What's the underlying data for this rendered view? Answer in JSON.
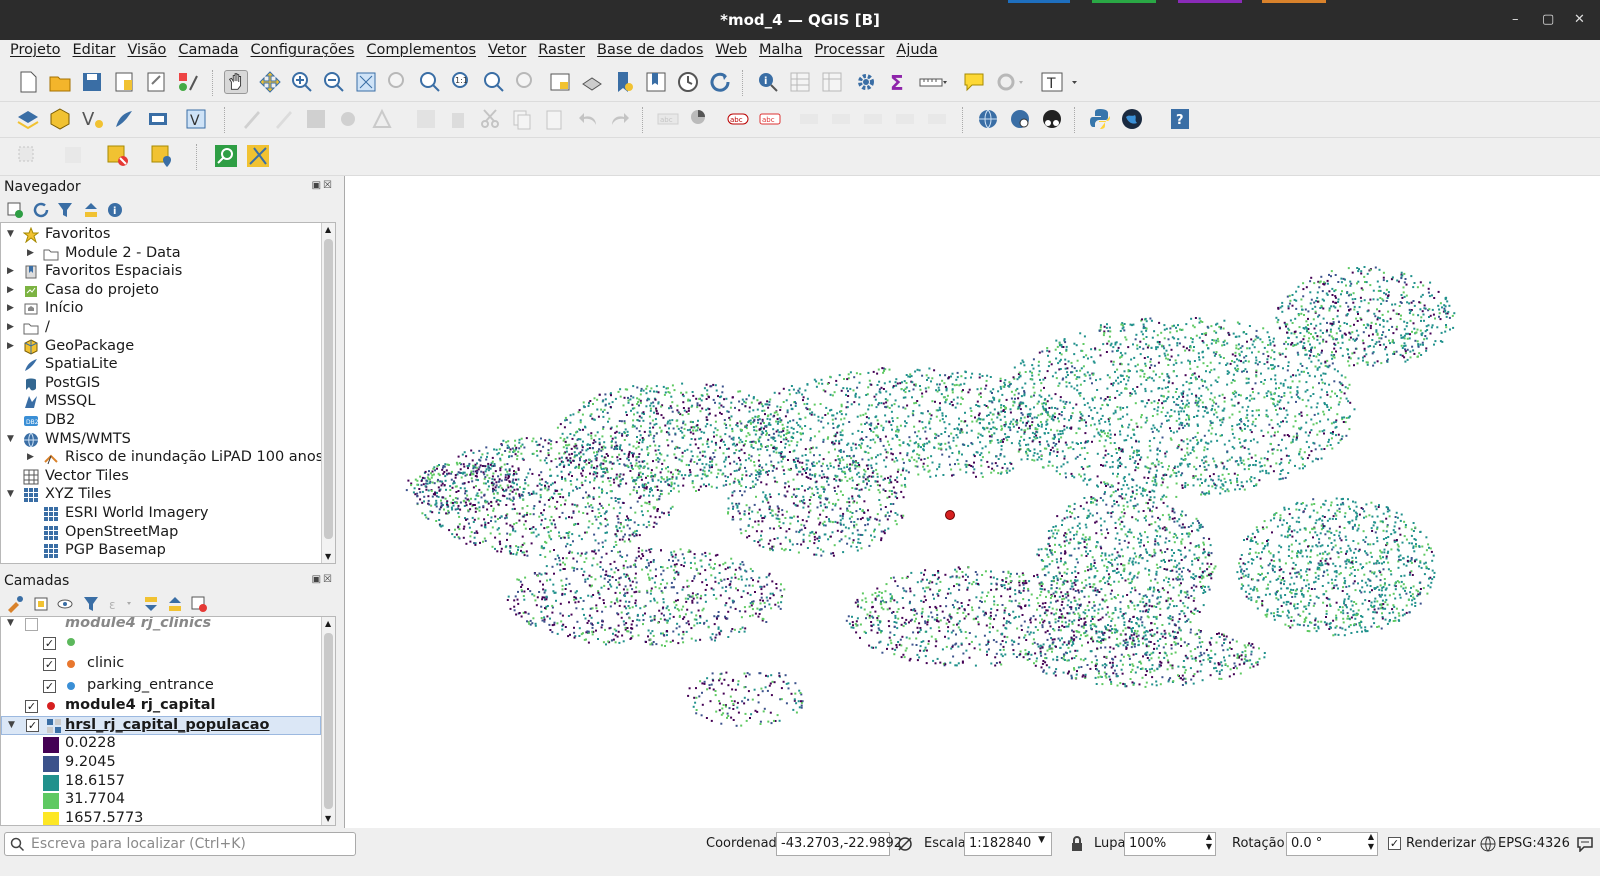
{
  "window": {
    "title": "*mod_4 — QGIS [B]"
  },
  "menu": [
    "Projeto",
    "Editar",
    "Visão",
    "Camada",
    "Configurações",
    "Complementos",
    "Vetor",
    "Raster",
    "Base de dados",
    "Web",
    "Malha",
    "Processar",
    "Ajuda"
  ],
  "navigator": {
    "title": "Navegador",
    "items": [
      {
        "label": "Favoritos",
        "icon": "star-icon",
        "expand": "open",
        "indent": 0
      },
      {
        "label": "Module 2 - Data",
        "icon": "folder-icon",
        "expand": "closed",
        "indent": 1
      },
      {
        "label": "Favoritos Espaciais",
        "icon": "spatial-bookmark-icon",
        "expand": "closed",
        "indent": 0
      },
      {
        "label": "Casa do projeto",
        "icon": "project-home-icon",
        "expand": "closed",
        "indent": 0
      },
      {
        "label": "Início",
        "icon": "home-folder-icon",
        "expand": "closed",
        "indent": 0
      },
      {
        "label": "/",
        "icon": "folder-icon",
        "expand": "closed",
        "indent": 0
      },
      {
        "label": "GeoPackage",
        "icon": "geopackage-icon",
        "expand": "closed",
        "indent": 0
      },
      {
        "label": "SpatiaLite",
        "icon": "spatialite-icon",
        "expand": "none",
        "indent": 0
      },
      {
        "label": "PostGIS",
        "icon": "postgis-icon",
        "expand": "none",
        "indent": 0
      },
      {
        "label": "MSSQL",
        "icon": "mssql-icon",
        "expand": "none",
        "indent": 0
      },
      {
        "label": "DB2",
        "icon": "db2-icon",
        "expand": "none",
        "indent": 0
      },
      {
        "label": "WMS/WMTS",
        "icon": "globe-icon",
        "expand": "open",
        "indent": 0
      },
      {
        "label": "Risco de inundação LiPAD 100 anos",
        "icon": "wms-layer-icon",
        "expand": "closed",
        "indent": 1
      },
      {
        "label": "Vector Tiles",
        "icon": "vector-tiles-icon",
        "expand": "none",
        "indent": 0
      },
      {
        "label": "XYZ Tiles",
        "icon": "xyz-tiles-icon",
        "expand": "open",
        "indent": 0
      },
      {
        "label": "ESRI World Imagery",
        "icon": "xyz-tiles-icon",
        "expand": "none",
        "indent": 1
      },
      {
        "label": "OpenStreetMap",
        "icon": "xyz-tiles-icon",
        "expand": "none",
        "indent": 1
      },
      {
        "label": "PGP Basemap",
        "icon": "xyz-tiles-icon",
        "expand": "none",
        "indent": 1
      }
    ]
  },
  "layers": {
    "title": "Camadas",
    "group_partial": "module4 rj_clinics",
    "clinic_subclasses": [
      {
        "label": "",
        "color": "#5cb85c"
      },
      {
        "label": "clinic",
        "color": "#e8772e"
      },
      {
        "label": "parking_entrance",
        "color": "#3a8fd6"
      }
    ],
    "capital_layer": {
      "label": "module4 rj_capital",
      "color": "#d62020"
    },
    "population_layer": {
      "label": "hrsl_rj_capital_populacao"
    },
    "legend": [
      {
        "value": "0.0228",
        "color": "#440154"
      },
      {
        "value": "9.2045",
        "color": "#3b528b"
      },
      {
        "value": "18.6157",
        "color": "#21918c"
      },
      {
        "value": "31.7704",
        "color": "#5ec962"
      },
      {
        "value": "1657.5773",
        "color": "#fde725"
      }
    ]
  },
  "status": {
    "locator_placeholder": "Escreva para localizar (Ctrl+K)",
    "coord_label": "Coordenada",
    "coord_value": "-43.2703,-22.9892",
    "scale_label": "Escala",
    "scale_value": "1:182840",
    "magnifier_label": "Lupa",
    "magnifier_value": "100%",
    "rotation_label": "Rotação",
    "rotation_value": "0.0 °",
    "render_label": "Renderizar",
    "crs": "EPSG:4326"
  },
  "colors": {
    "accent_selected": "#dbe7f6",
    "density_palette": [
      "#440154",
      "#3b528b",
      "#21918c",
      "#5ec962",
      "#fde725"
    ]
  }
}
